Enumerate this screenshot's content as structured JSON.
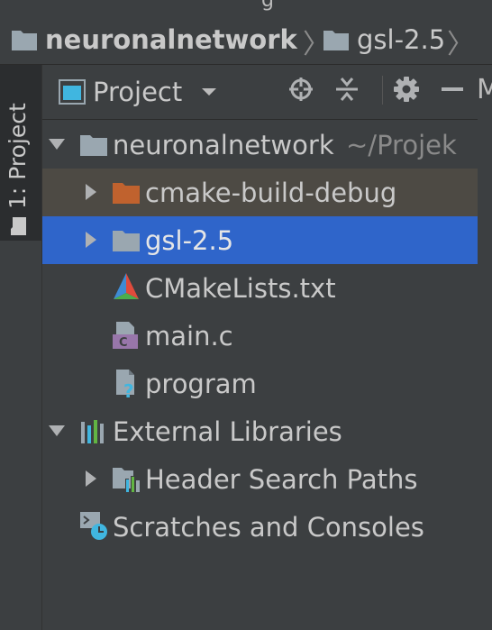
{
  "breadcrumb": {
    "top_cut": "g",
    "items": [
      {
        "label": "neuronalnetwork"
      },
      {
        "label": "gsl-2.5"
      }
    ]
  },
  "stripe": {
    "label": "1: Project"
  },
  "panel": {
    "view_label": "Project",
    "header_icons": [
      "locate-icon",
      "collapse-all-icon",
      "gear-icon",
      "minimize-icon"
    ],
    "header_cut": "M"
  },
  "tree": [
    {
      "label": "neuronalnetwork",
      "hint": "~/Projek",
      "icon": "folder-icon",
      "expanded": true
    },
    {
      "label": "cmake-build-debug",
      "icon": "folder-orange-icon",
      "expanded": false
    },
    {
      "label": "gsl-2.5",
      "icon": "folder-icon",
      "expanded": false,
      "selected": true
    },
    {
      "label": "CMakeLists.txt",
      "icon": "cmake-icon"
    },
    {
      "label": "main.c",
      "icon": "c-file-icon"
    },
    {
      "label": "program",
      "icon": "unknown-file-icon"
    },
    {
      "label": "External Libraries",
      "icon": "libraries-icon",
      "expanded": true
    },
    {
      "label": "Header Search Paths",
      "icon": "header-paths-icon",
      "expanded": false
    },
    {
      "label": "Scratches and Consoles",
      "icon": "scratches-icon"
    }
  ],
  "colors": {
    "selection": "#2f65ca",
    "excluded_folder_row": "#4d4a44",
    "folder": "#9aa7b0",
    "excluded_folder": "#c0622e"
  }
}
